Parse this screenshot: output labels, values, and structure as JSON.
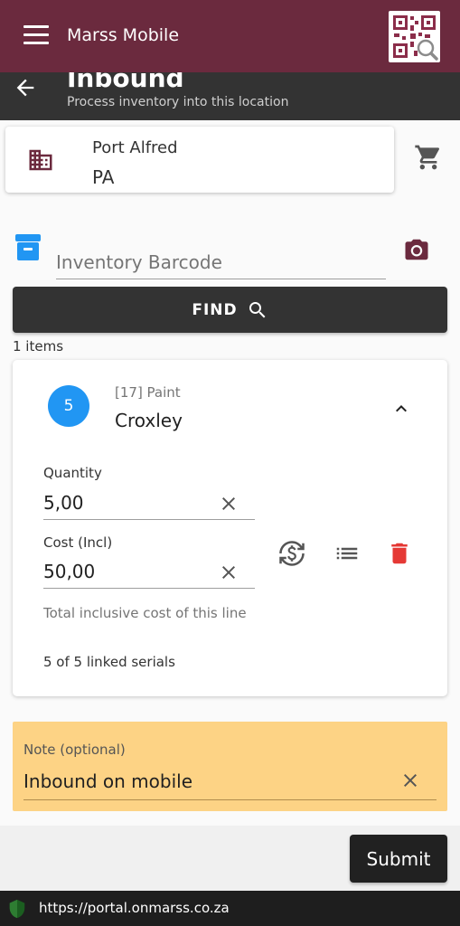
{
  "app": {
    "title": "Marss Mobile"
  },
  "page": {
    "title": "Inbound",
    "subtitle": "Process inventory into this location"
  },
  "location": {
    "name": "Port Alfred",
    "code": "PA"
  },
  "search": {
    "placeholder": "Inventory Barcode",
    "value": "",
    "find_label": "FIND"
  },
  "items_count_label": "1 items",
  "item": {
    "badge": "5",
    "category": "[17] Paint",
    "name": "Croxley",
    "quantity_label": "Quantity",
    "quantity_value": "5,00",
    "cost_label": "Cost (Incl)",
    "cost_value": "50,00",
    "cost_helper": "Total inclusive cost of this line",
    "serials_text": "5 of 5 linked serials"
  },
  "note": {
    "label": "Note (optional)",
    "value": "Inbound on mobile"
  },
  "submit_label": "Submit",
  "browser": {
    "url": "https://portal.onmarss.co.za"
  },
  "colors": {
    "app_bar": "#6b2a3e",
    "sub_bar": "#333333",
    "badge_blue": "#2196f3",
    "note_bg": "#fdd385",
    "delete_red": "#e53935",
    "icon_maroon": "#6b2a3e",
    "archive_blue": "#2196f3"
  },
  "icons": {
    "menu": "menu-icon",
    "qr": "qr-scan-icon",
    "back": "arrow-back-icon",
    "building": "building-icon",
    "cart": "cart-icon",
    "archive": "archive-icon",
    "camera": "camera-icon",
    "search": "search-icon",
    "collapse": "chevron-up-icon",
    "clear": "close-icon",
    "currency_exchange": "currency-exchange-icon",
    "list": "list-icon",
    "delete": "trash-icon",
    "shield": "shield-icon"
  }
}
